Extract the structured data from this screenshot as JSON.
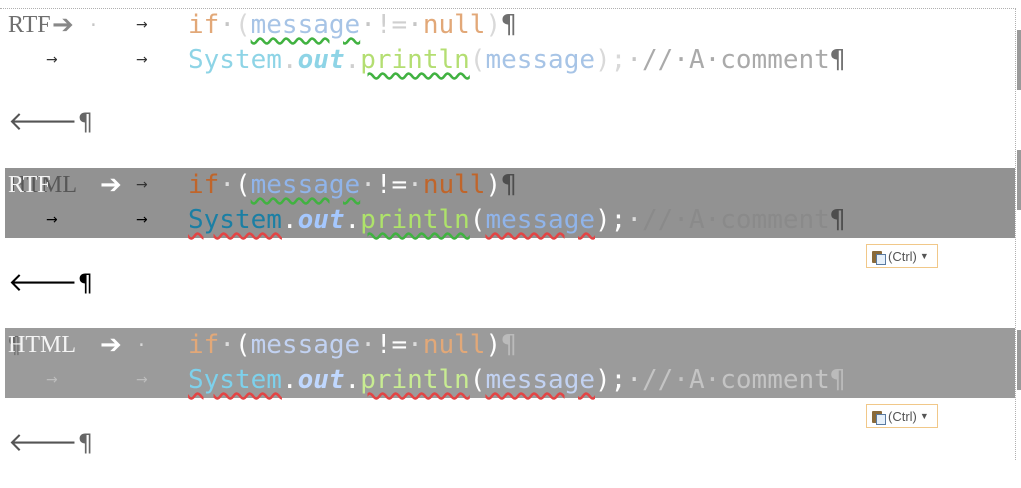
{
  "blocks": [
    {
      "label": "RTF",
      "code": {
        "kw_if": "if",
        "open_paren": "(",
        "message": "message",
        "neq": "!=",
        "null": "null",
        "close_paren": ")",
        "pilcrow": "¶",
        "system": "System",
        "dot": ".",
        "out": "out",
        "println": "println",
        "semicolon": ";",
        "comment": "//·A·comment"
      }
    },
    {
      "label": "RTF",
      "ghost_label": "HTML",
      "paste_label": "(Ctrl)",
      "code": {
        "kw_if": "if",
        "open_paren": "(",
        "message": "message",
        "neq": "!=",
        "null": "null",
        "close_paren": ")",
        "pilcrow": "¶",
        "system": "System",
        "dot": ".",
        "out": "out",
        "println": "println",
        "semicolon": ";",
        "comment": "//·A·comment"
      }
    },
    {
      "label": "HTML",
      "ghost_label": "¶",
      "paste_label": "(Ctrl)",
      "code": {
        "kw_if": "if",
        "open_paren": "(",
        "message": "message",
        "neq": "!=",
        "null": "null",
        "close_paren": ")",
        "pilcrow": "¶",
        "system": "System",
        "dot": ".",
        "out": "out",
        "println": "println",
        "semicolon": ";",
        "comment": "//·A·comment"
      }
    }
  ],
  "glyphs": {
    "tab_arrow": "→",
    "big_arrow": "➔",
    "back_arrow": "🡐",
    "middot": "·",
    "pilcrow": "¶",
    "caret": "▼"
  },
  "icons": [
    "paste-options-icon",
    "dropdown-caret-icon"
  ]
}
